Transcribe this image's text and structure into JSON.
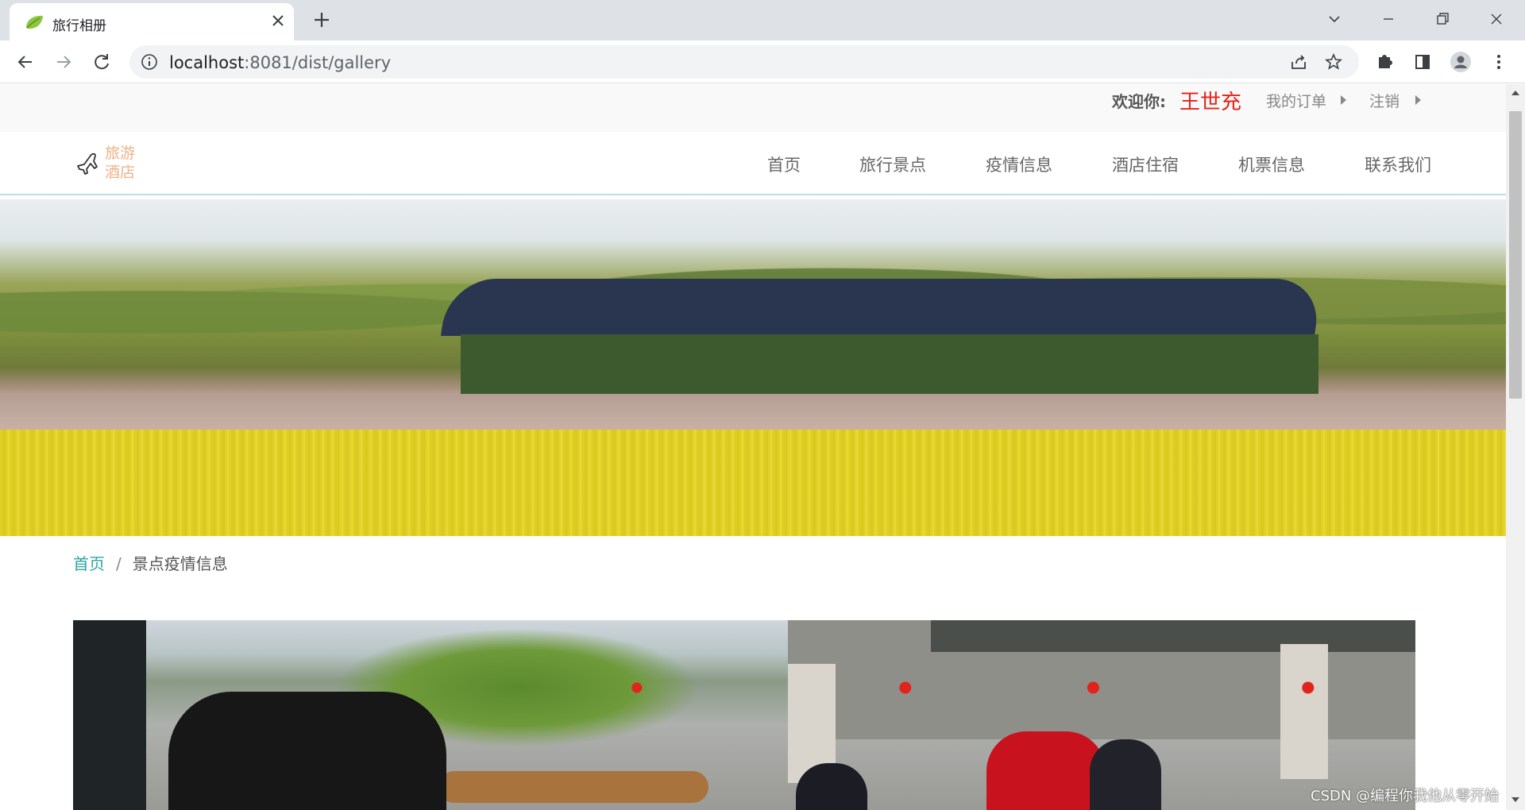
{
  "browser": {
    "tab_title": "旅行相册",
    "url_host": "localhost",
    "url_rest": ":8081/dist/gallery"
  },
  "topbar": {
    "welcome_label": "欢迎你:",
    "username": "王世充",
    "orders_link": "我的订单",
    "logout_link": "注销"
  },
  "logo": {
    "line1": "旅游",
    "line2": "酒店"
  },
  "nav": {
    "items": [
      {
        "label": "首页"
      },
      {
        "label": "旅行景点"
      },
      {
        "label": "疫情信息"
      },
      {
        "label": "酒店住宿"
      },
      {
        "label": "机票信息"
      },
      {
        "label": "联系我们"
      }
    ]
  },
  "breadcrumb": {
    "home": "首页",
    "separator": "/",
    "current": "景点疫情信息"
  },
  "watermark": "CSDN @编程你我他从零开始",
  "colors": {
    "accent_teal": "#2ba6a2",
    "username_red": "#e4221a",
    "logo_orange": "#f0b187"
  },
  "icons": [
    "leaf-favicon-icon",
    "close-icon",
    "plus-icon",
    "back-icon",
    "forward-icon",
    "reload-icon",
    "info-icon",
    "share-icon",
    "star-icon",
    "puzzle-icon",
    "sidebar-icon",
    "profile-icon",
    "kebab-menu-icon",
    "airplane-icon"
  ]
}
